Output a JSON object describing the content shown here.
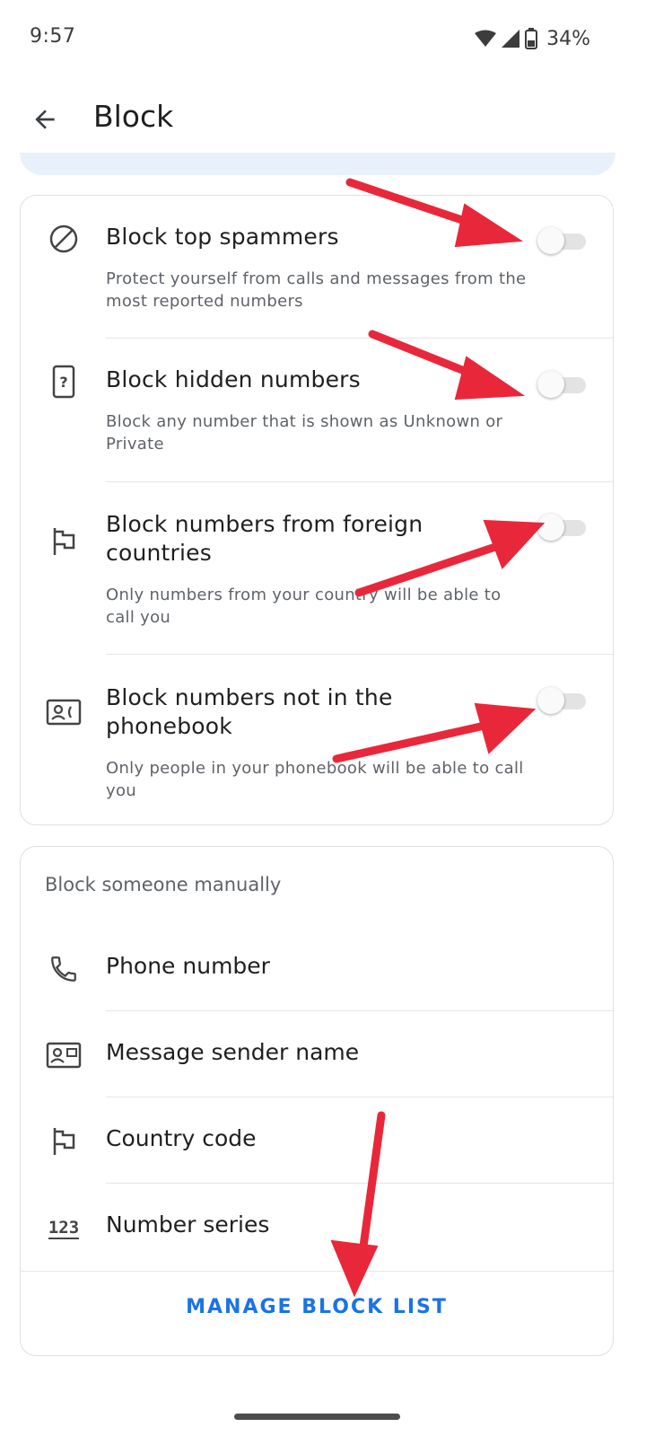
{
  "status_bar": {
    "time": "9:57",
    "battery_percent": "34%"
  },
  "header": {
    "title": "Block"
  },
  "block_settings": [
    {
      "title": "Block top spammers",
      "description": "Protect yourself from calls and messages from the most reported numbers",
      "enabled": false,
      "icon": "block-icon"
    },
    {
      "title": "Block hidden numbers",
      "description": "Block any number that is shown as Unknown or Private",
      "enabled": false,
      "icon": "hidden-phone-icon"
    },
    {
      "title": "Block numbers from foreign countries",
      "description": "Only numbers from your country will be able to call you",
      "enabled": false,
      "icon": "flag-icon"
    },
    {
      "title": "Block numbers not in the phonebook",
      "description": "Only people in your phonebook will be able to call you",
      "enabled": false,
      "icon": "contact-card-icon"
    }
  ],
  "manual": {
    "heading": "Block someone manually",
    "items": [
      {
        "label": "Phone number",
        "icon": "phone-icon"
      },
      {
        "label": "Message sender name",
        "icon": "sender-card-icon"
      },
      {
        "label": "Country code",
        "icon": "flag-icon"
      },
      {
        "label": "Number series",
        "icon": "number-series-icon"
      }
    ],
    "action": "MANAGE BLOCK LIST"
  },
  "colors": {
    "accent": "#1a73e8",
    "annotation_arrow": "#e8283a"
  }
}
